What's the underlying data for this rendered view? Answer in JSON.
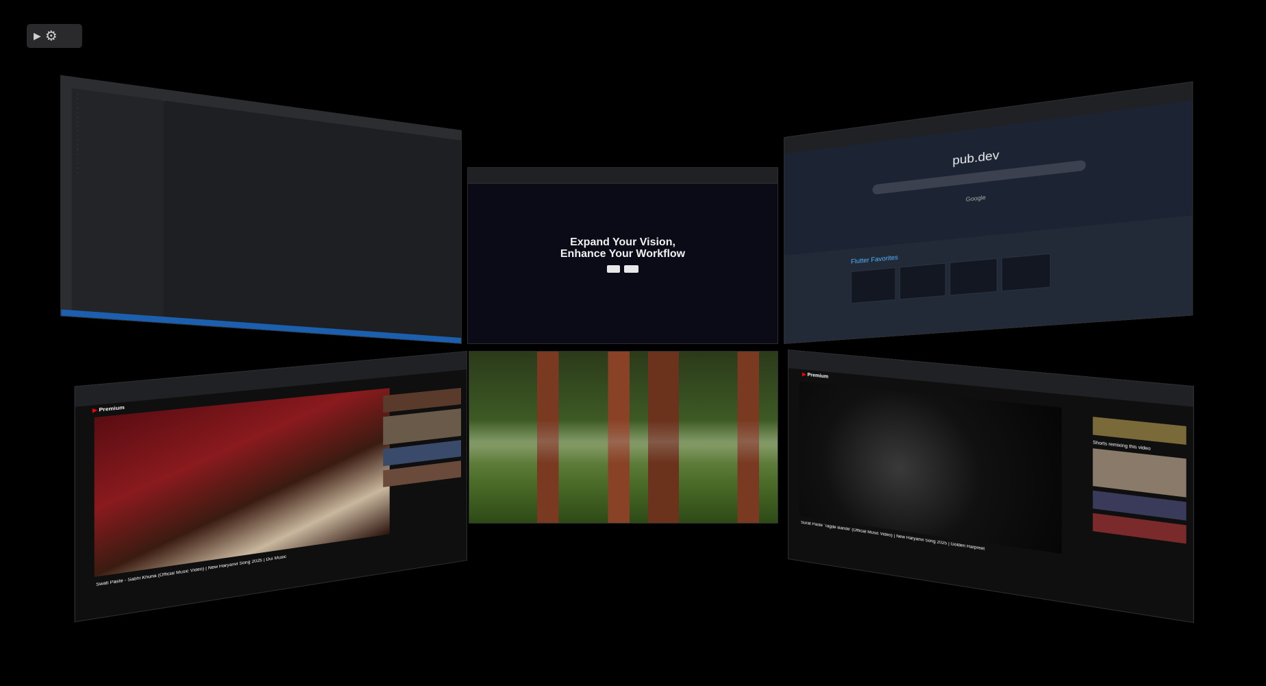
{
  "controls": {
    "play_glyph": "▶",
    "settings_glyph": "⚙"
  },
  "web": {
    "headline_1": "Expand Your Vision,",
    "headline_2": "Enhance Your Workflow"
  },
  "pub": {
    "logo_text": "pub.dev",
    "search_by": "Google",
    "favorites_title": "Flutter Favorites"
  },
  "yt1": {
    "brand": "Premium",
    "title": "Swati Paste - Sabhi Khuna (Official Music Video) | New Haryanvi Song 2025 | Dui Music"
  },
  "yt2": {
    "brand": "Premium",
    "title": "Surat Paste 'Tagde Bande' (Official Music Video) | New Haryanvi Song 2025 | Golden Harpreet",
    "shorts_heading": "Shorts remixing this video"
  },
  "colors": {
    "background": "#000000",
    "ide_status": "#1b5fae",
    "pub_accent": "#4fb3ff",
    "yt_red": "#ff0000"
  }
}
